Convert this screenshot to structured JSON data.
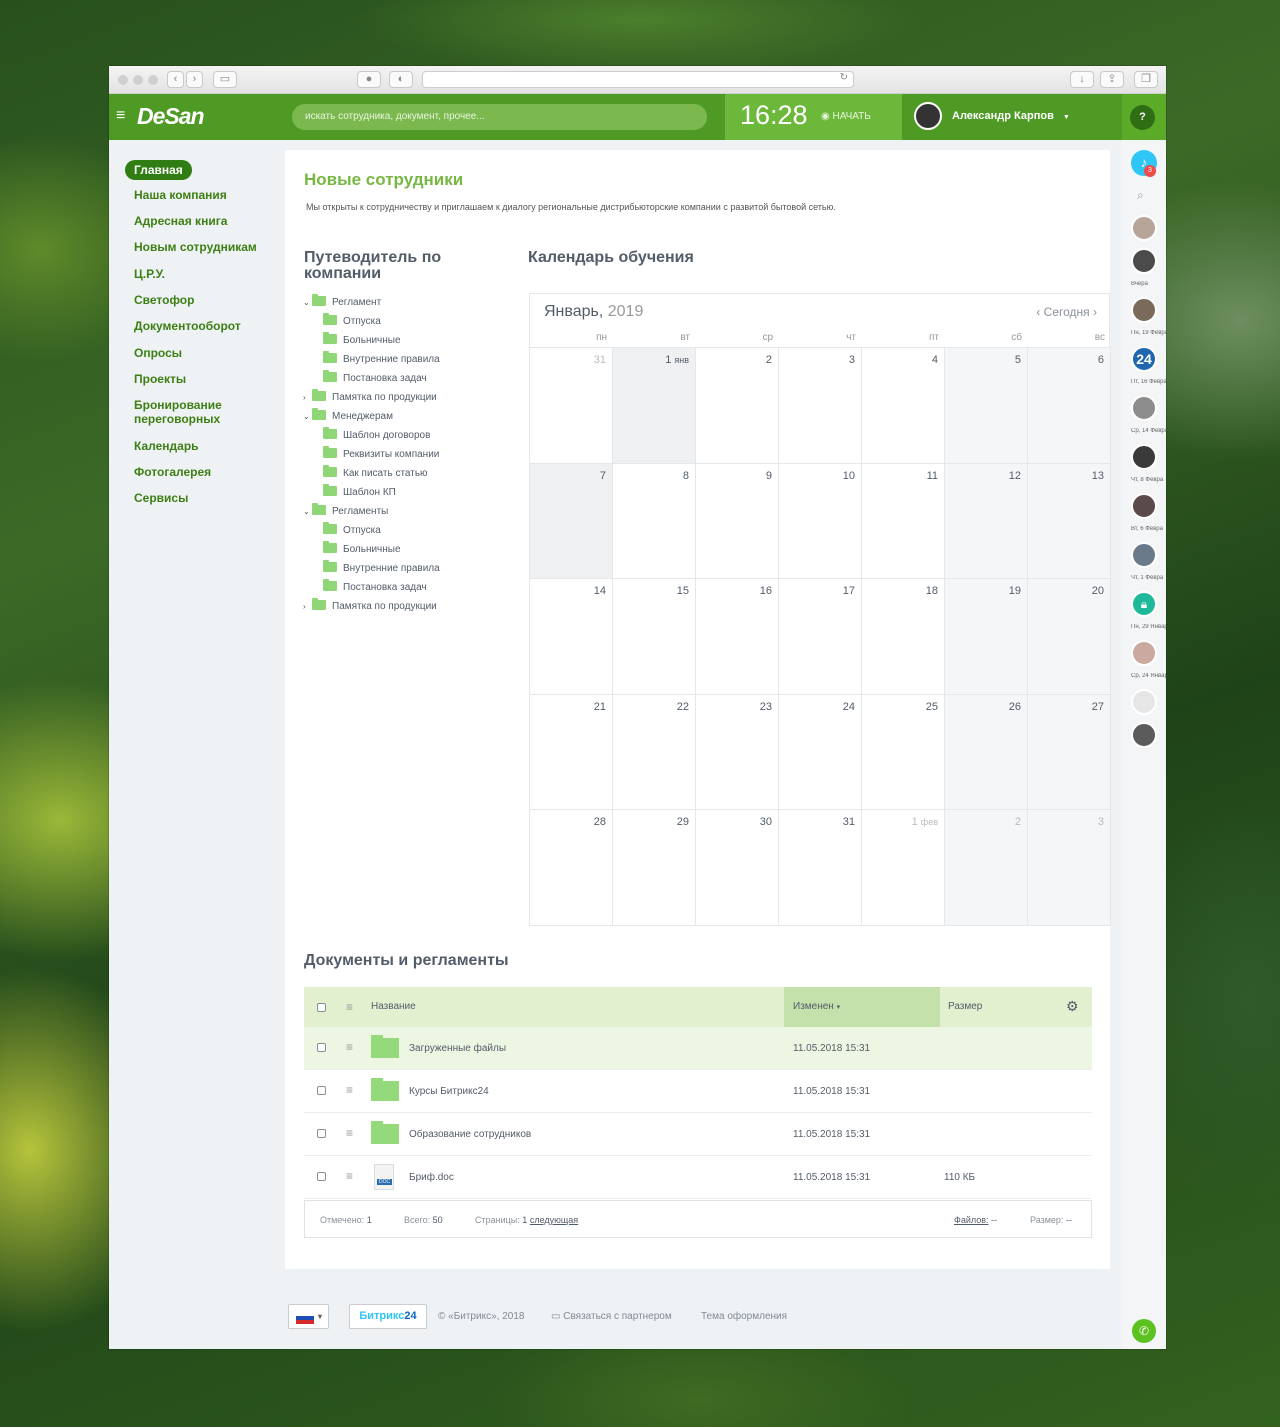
{
  "app": {
    "logo": "DeSan",
    "search_placeholder": "искать сотрудника, документ, прочее...",
    "clock": "16:28",
    "start_label": "НАЧАТЬ",
    "user_name": "Александр Карпов",
    "help_label": "?"
  },
  "nav": {
    "items": [
      "Главная",
      "Наша компания",
      "Адресная книга",
      "Новым сотрудникам",
      "Ц.Р.У.",
      "Светофор",
      "Документооборот",
      "Опросы",
      "Проекты",
      "Бронирование переговорных",
      "Календарь",
      "Фотогалерея",
      "Сервисы"
    ]
  },
  "page": {
    "title": "Новые сотрудники",
    "intro": "Мы открыты к сотрудничеству и приглашаем к диалогу региональные дистрибьюторские компании с развитой бытовой сетью."
  },
  "guide": {
    "title": "Путеводитель по компании",
    "items": [
      {
        "level": 0,
        "open": "v",
        "label": "Регламент"
      },
      {
        "level": 1,
        "label": "Отпуска"
      },
      {
        "level": 1,
        "label": "Больничные"
      },
      {
        "level": 1,
        "label": "Внутренние правила"
      },
      {
        "level": 1,
        "label": "Постановка задач"
      },
      {
        "level": 0,
        "open": ">",
        "label": "Памятка по продукции"
      },
      {
        "level": 0,
        "open": "v",
        "label": "Менеджерам"
      },
      {
        "level": 1,
        "label": "Шаблон договоров"
      },
      {
        "level": 1,
        "label": "Реквизиты компании"
      },
      {
        "level": 1,
        "label": "Как писать статью"
      },
      {
        "level": 1,
        "label": "Шаблон КП"
      },
      {
        "level": 0,
        "open": "v",
        "label": "Регламенты"
      },
      {
        "level": 1,
        "label": "Отпуска"
      },
      {
        "level": 1,
        "label": "Больничные"
      },
      {
        "level": 1,
        "label": "Внутренние правила"
      },
      {
        "level": 1,
        "label": "Постановка задач"
      },
      {
        "level": 0,
        "open": ">",
        "label": "Памятка по продукции"
      }
    ]
  },
  "calendar": {
    "title": "Календарь обучения",
    "month": "Январь,",
    "year": "2019",
    "today": "Сегодня",
    "weekdays": [
      "пн",
      "вт",
      "ср",
      "чт",
      "пт",
      "сб",
      "вс"
    ],
    "weeks": [
      [
        {
          "d": "31",
          "off": true
        },
        {
          "d": "1",
          "m": "янв"
        },
        {
          "d": "2"
        },
        {
          "d": "3"
        },
        {
          "d": "4"
        },
        {
          "d": "5"
        },
        {
          "d": "6"
        }
      ],
      [
        {
          "d": "7"
        },
        {
          "d": "8"
        },
        {
          "d": "9"
        },
        {
          "d": "10"
        },
        {
          "d": "11"
        },
        {
          "d": "12"
        },
        {
          "d": "13"
        }
      ],
      [
        {
          "d": "14"
        },
        {
          "d": "15"
        },
        {
          "d": "16"
        },
        {
          "d": "17"
        },
        {
          "d": "18"
        },
        {
          "d": "19"
        },
        {
          "d": "20"
        }
      ],
      [
        {
          "d": "21"
        },
        {
          "d": "22"
        },
        {
          "d": "23"
        },
        {
          "d": "24"
        },
        {
          "d": "25"
        },
        {
          "d": "26"
        },
        {
          "d": "27"
        }
      ],
      [
        {
          "d": "28"
        },
        {
          "d": "29"
        },
        {
          "d": "30"
        },
        {
          "d": "31"
        },
        {
          "d": "1",
          "m": "фев",
          "off": true
        },
        {
          "d": "2",
          "off": true
        },
        {
          "d": "3",
          "off": true
        }
      ]
    ]
  },
  "docs": {
    "title": "Документы и регламенты",
    "columns": {
      "name": "Название",
      "changed": "Изменен",
      "size": "Размер"
    },
    "rows": [
      {
        "type": "folder",
        "name": "Загруженные файлы",
        "date": "11.05.2018 15:31",
        "size": ""
      },
      {
        "type": "folder",
        "name": "Курсы Битрикс24",
        "date": "11.05.2018 15:31",
        "size": ""
      },
      {
        "type": "folder",
        "name": "Образование сотрудников",
        "date": "11.05.2018 15:31",
        "size": ""
      },
      {
        "type": "doc",
        "name": "Бриф.doc",
        "date": "11.05.2018 15:31",
        "size": "110 КБ"
      }
    ],
    "footer": {
      "selected_label": "Отмечено:",
      "selected": "1",
      "total_label": "Всего:",
      "total": "50",
      "pages_label": "Страницы:",
      "page": "1",
      "next": "следующая",
      "files_label": "Файлов:",
      "files": "--",
      "size_label": "Размер:",
      "size": "--"
    }
  },
  "footer": {
    "brand_a": "Битрикс",
    "brand_b": "24",
    "copyright": "© «Битрикс», 2018",
    "partner": "Связаться с партнером",
    "theme": "Тема оформления"
  },
  "right": {
    "badge": "3",
    "labels": [
      "Вчера",
      "Пн, 19 Февра",
      "Пт, 16 Февра",
      "Ср, 14 Февра",
      "Чт, 8 Февра",
      "Вт, 6 Февра",
      "Чт, 1 Февра",
      "Пн, 29 Январ",
      "Ср, 24 Январ"
    ],
    "b24": "24"
  },
  "colors": {
    "accent": "#5bab29",
    "brand_dark": "#2f7d13",
    "folder": "#8fd676"
  }
}
